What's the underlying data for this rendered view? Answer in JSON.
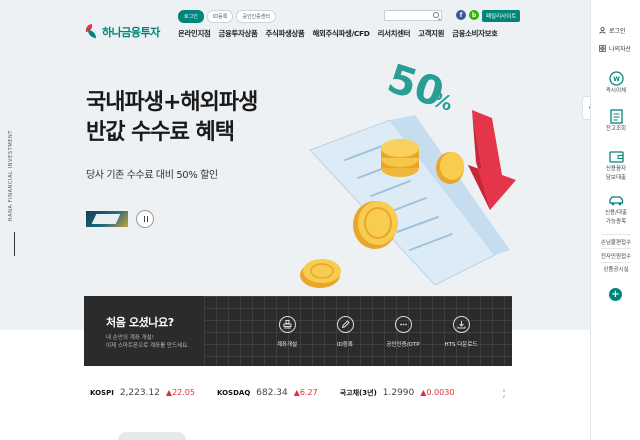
{
  "brand": {
    "name": "하나금융투자",
    "vertical_text": "HANA FINANCIAL INVESTMENT",
    "accent": "#00857a"
  },
  "top_links": [
    "로그인",
    "ID등록",
    "공인인증센터"
  ],
  "search": {
    "placeholder": ""
  },
  "sns": {
    "facebook": "f",
    "blog": "b"
  },
  "family_site": "패밀리사이트",
  "gnb": [
    "온라인지점",
    "금융투자상품",
    "주식파생상품",
    "해외주식파생/CFD",
    "리서치센터",
    "고객지원",
    "금융소비자보호"
  ],
  "hero": {
    "title_line1": "국내파생+해외파생",
    "title_line2": "반값 수수료 혜택",
    "subtitle": "당사 기존 수수료 대비 50% 할인",
    "badge": "50",
    "badge_unit": "%"
  },
  "quick": {
    "title": "처음 오셨나요?",
    "desc_line1": "내 손안의 계좌 개설!",
    "desc_line2": "이제 스마트폰으로 계좌를 만드세요.",
    "items": [
      {
        "label": "계좌개설",
        "icon": "stamp-icon"
      },
      {
        "label": "ID등록",
        "icon": "pen-icon"
      },
      {
        "label": "공인인증/OTP",
        "icon": "dots-icon"
      },
      {
        "label": "HTS 다운로드",
        "icon": "download-icon"
      }
    ]
  },
  "ticker": [
    {
      "name": "KOSPI",
      "value": "2,223.12",
      "change": "▲22.05"
    },
    {
      "name": "KOSDAQ",
      "value": "682.34",
      "change": "▲6.27"
    },
    {
      "name": "국고채(3년)",
      "value": "1.2990",
      "change": "▲0.0030"
    }
  ],
  "right_panel": {
    "login": "로그인",
    "my_assets": "나의자산",
    "items": [
      {
        "label1": "즉시이체",
        "label2": ""
      },
      {
        "label1": "잔고조회",
        "label2": ""
      },
      {
        "label1": "신용융자",
        "label2": "담보대출"
      },
      {
        "label1": "신용/대출",
        "label2": "가능종목"
      }
    ],
    "texts": [
      "손님불편접수",
      "전자민원접수",
      "상품공시실"
    ]
  }
}
